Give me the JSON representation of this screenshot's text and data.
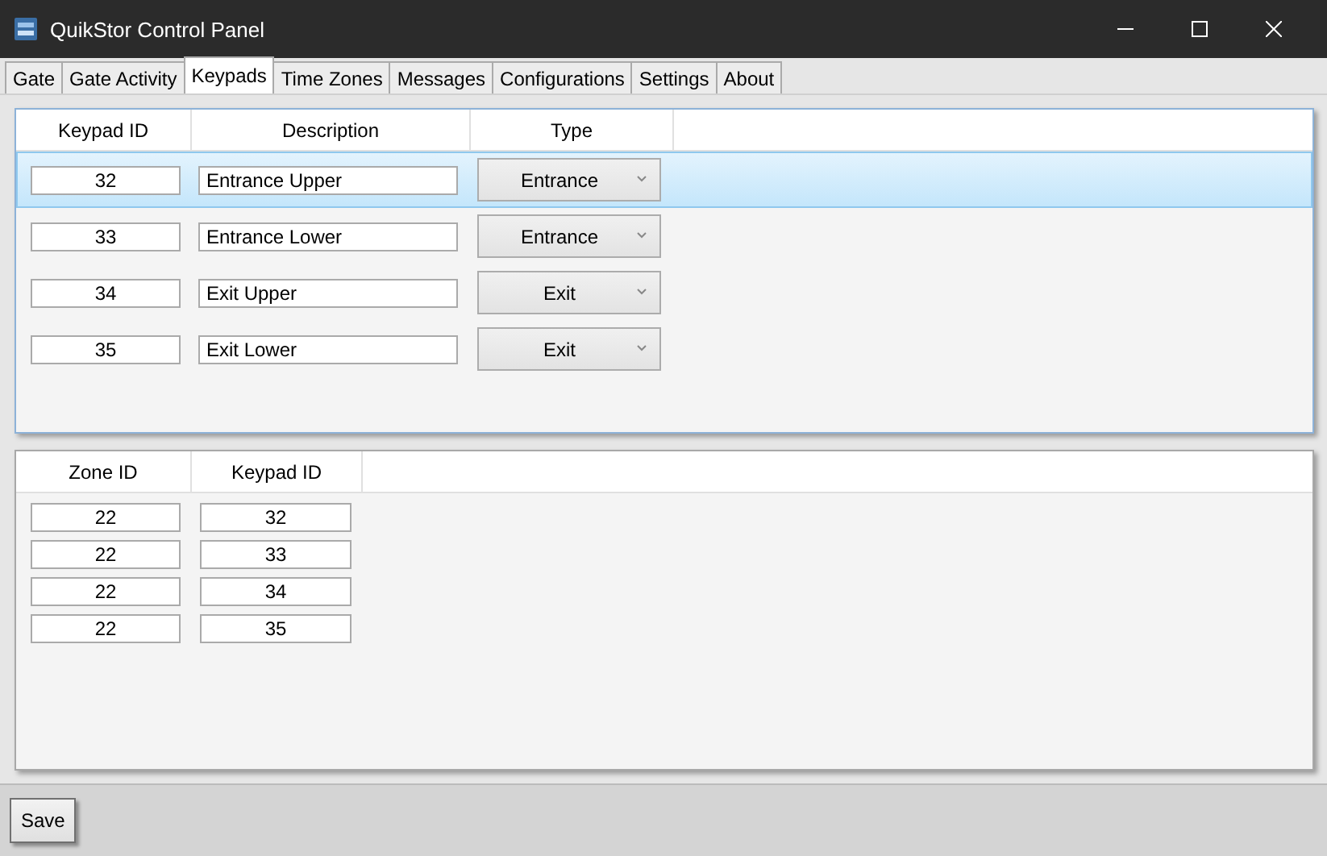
{
  "window": {
    "title": "QuikStor Control Panel"
  },
  "tabs": [
    {
      "label": "Gate",
      "selected": false
    },
    {
      "label": "Gate Activity",
      "selected": false
    },
    {
      "label": "Keypads",
      "selected": true
    },
    {
      "label": "Time Zones",
      "selected": false
    },
    {
      "label": "Messages",
      "selected": false
    },
    {
      "label": "Configurations",
      "selected": false
    },
    {
      "label": "Settings",
      "selected": false
    },
    {
      "label": "About",
      "selected": false
    }
  ],
  "keypads": {
    "columns": [
      "Keypad ID",
      "Description",
      "Type"
    ],
    "rows": [
      {
        "id": "32",
        "description": "Entrance Upper",
        "type": "Entrance",
        "selected": true
      },
      {
        "id": "33",
        "description": "Entrance Lower",
        "type": "Entrance",
        "selected": false
      },
      {
        "id": "34",
        "description": "Exit Upper",
        "type": "Exit",
        "selected": false
      },
      {
        "id": "35",
        "description": "Exit Lower",
        "type": "Exit",
        "selected": false
      }
    ]
  },
  "zones": {
    "columns": [
      "Zone ID",
      "Keypad ID"
    ],
    "rows": [
      {
        "zone_id": "22",
        "keypad_id": "32"
      },
      {
        "zone_id": "22",
        "keypad_id": "33"
      },
      {
        "zone_id": "22",
        "keypad_id": "34"
      },
      {
        "zone_id": "22",
        "keypad_id": "35"
      }
    ]
  },
  "buttons": [
    "Save"
  ]
}
